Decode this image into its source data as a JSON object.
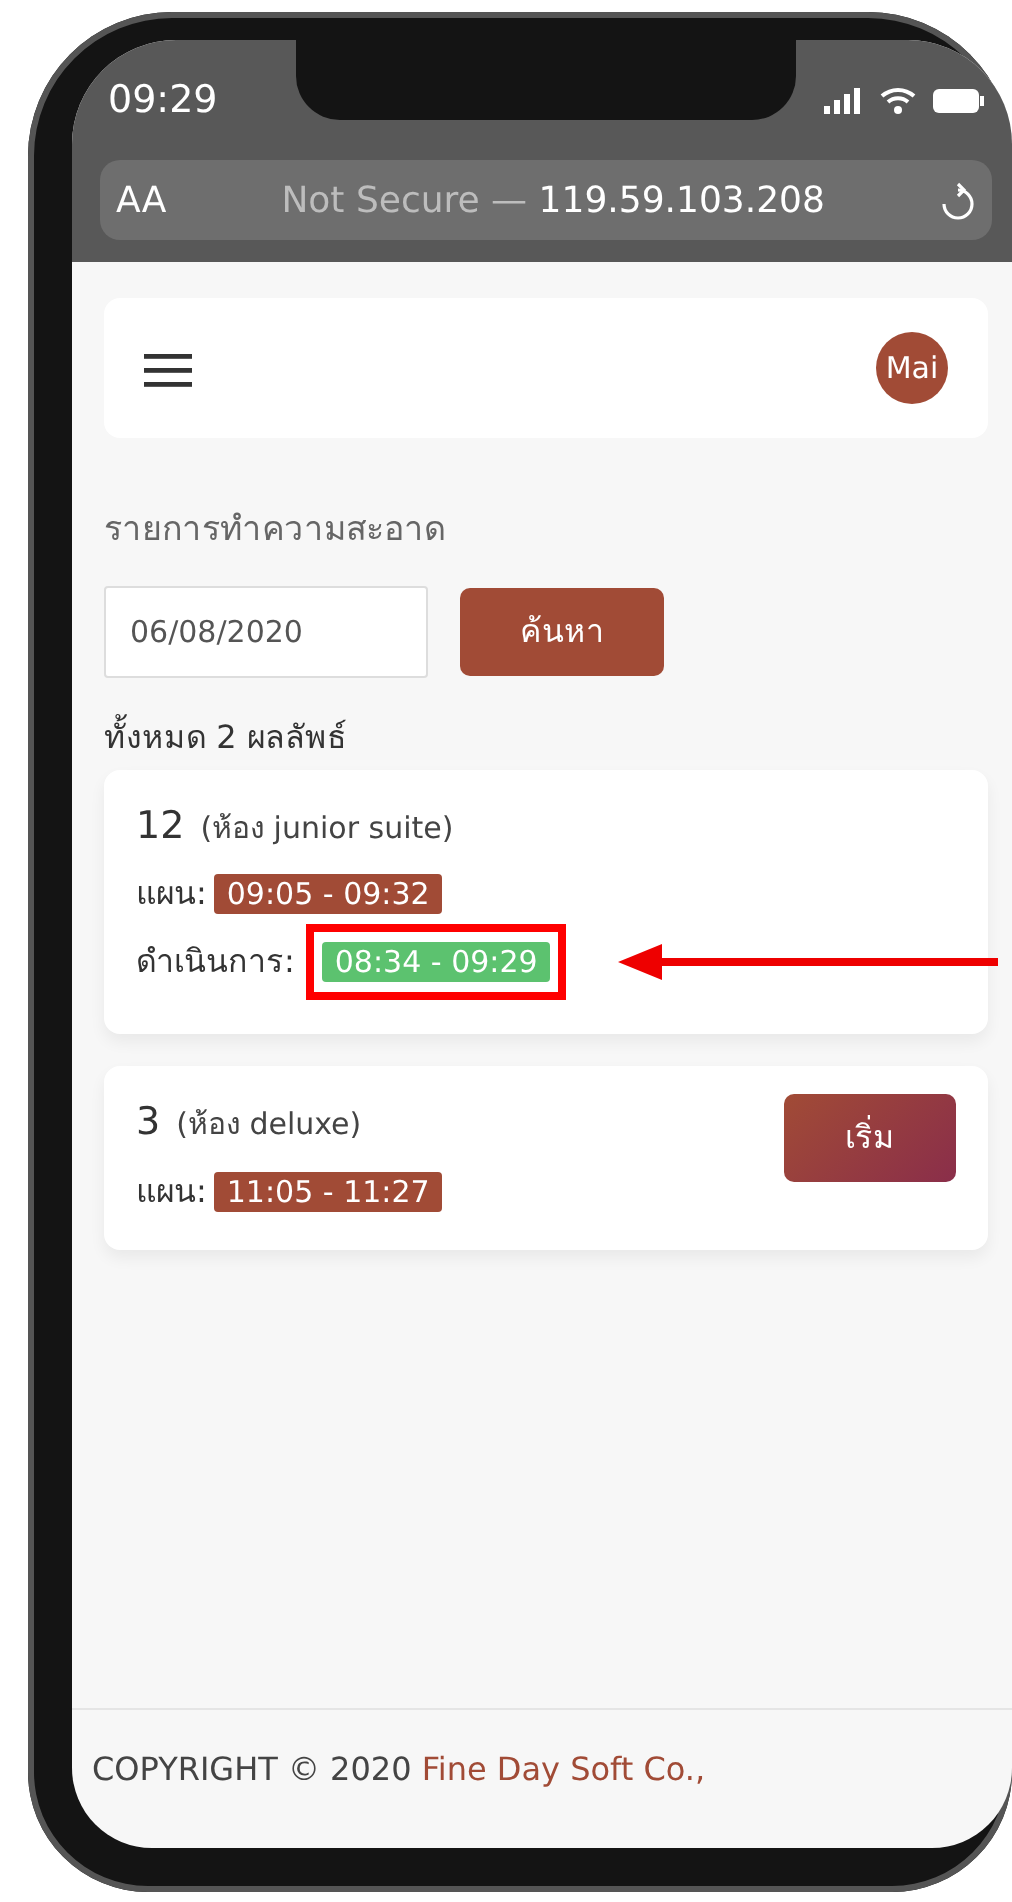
{
  "status_bar": {
    "time": "09:29"
  },
  "browser_bar": {
    "text_size": "AA",
    "security": "Not Secure —",
    "address": "119.59.103.208"
  },
  "navbar": {
    "avatar": "Mai"
  },
  "page_title": "รายการทำความสะอาด",
  "search": {
    "date": "06/08/2020",
    "button": "ค้นหา"
  },
  "result_count": "ทั้งหมด 2 ผลลัพธ์",
  "rooms": [
    {
      "number": "12",
      "type": "(ห้อง junior suite)",
      "times": [
        {
          "kind": "plan",
          "label": "แผน:",
          "time": "09:05 - 09:32",
          "highlighted": false
        },
        {
          "kind": "actual",
          "label": "ดำเนินการ:",
          "time": "08:34 - 09:29",
          "highlighted": true
        }
      ]
    },
    {
      "number": "3",
      "type": "(ห้อง deluxe)",
      "button": "เริ่ม",
      "times": [
        {
          "kind": "plan",
          "label": "แผน:",
          "time": "11:05 - 11:27",
          "highlighted": false
        }
      ]
    }
  ],
  "footer": {
    "copyright": "COPYRIGHT © 2020",
    "company": "Fine Day Soft Co.,"
  }
}
